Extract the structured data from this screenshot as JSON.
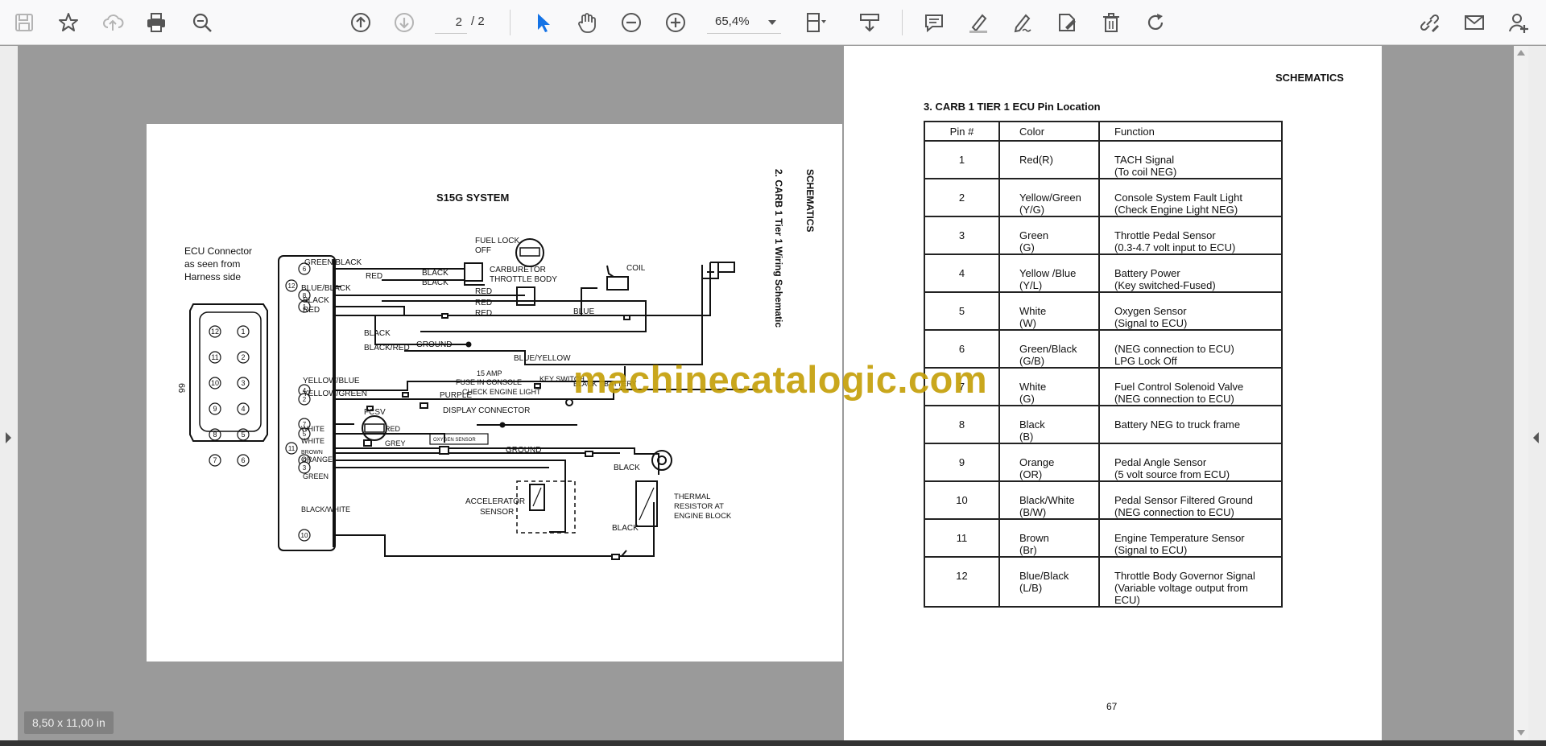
{
  "toolbar": {
    "icons": [
      "save-icon",
      "bookmark-star-icon",
      "cloud-upload-icon",
      "print-icon",
      "search-zoom-icon",
      "arrow-up-circle-icon",
      "arrow-down-circle-icon",
      "cursor-icon",
      "hand-icon",
      "zoom-out-icon",
      "zoom-in-icon",
      "fit-page-icon",
      "scroll-mode-icon",
      "comment-icon",
      "highlighter-icon",
      "sign-pen-icon",
      "stamp-icon",
      "delete-icon",
      "rotate-icon",
      "link-edit-icon",
      "mail-icon",
      "user-add-icon"
    ],
    "page_current": "2",
    "page_total": "/ 2",
    "zoom": "65,4%"
  },
  "status": {
    "page_size": "8,50 x 11,00 in"
  },
  "watermark": "machinecatalogic.com",
  "left_page": {
    "system_title": "S15G SYSTEM",
    "section_vertical": "SCHEMATICS",
    "diagram_vertical": "2. CARB 1 Tier 1 Wiring Schematic",
    "ecu_connector_label_1": "ECU Connector",
    "ecu_connector_label_2": "as seen from",
    "ecu_connector_label_3": "Harness side",
    "connector_code": "66",
    "connector_pins_left": [
      "12",
      "11",
      "10",
      "9",
      "8",
      "7"
    ],
    "connector_pins_right": [
      "1",
      "2",
      "3",
      "4",
      "5",
      "6"
    ],
    "labels": {
      "green_black": "GREEN/BLACK",
      "blue_black": "BLUE/BLACK",
      "black": "BLACK",
      "red": "RED",
      "red2": "RED",
      "red3": "RED",
      "red4": "RED",
      "black2": "BLACK",
      "black3": "BLACK",
      "black_red": "BLACK/RED",
      "ground1": "GROUND",
      "yellow_blue": "YELLOW/BLUE",
      "yellow_green": "YELLOW/GREEN",
      "purple": "PURPLE",
      "display_connector": "DISPLAY CONNECTOR",
      "fcsv": "FCSV",
      "white": "WHITE",
      "red5": "RED",
      "white2": "WHITE",
      "grey": "GREY",
      "oxygen_sensor": "OXYGEN SENSOR",
      "ground2": "GROUND",
      "brown": "BROWN",
      "orange": "ORANGE",
      "green": "GREEN",
      "black_white": "BLACK/WHITE",
      "fuel_lock": "FUEL LOCK",
      "off": "OFF",
      "carburetor": "CARBURETOR",
      "throttle_body": "THROTTLE BODY",
      "coil": "COIL",
      "blue": "BLUE",
      "blue_yellow": "BLUE/YELLOW",
      "fuse_1": "15 AMP",
      "fuse_2": "FUSE IN CONSOLE",
      "key_switch": "KEY SWITCH",
      "black_battery": "BLACK",
      "battery": "BATTERY",
      "check_engine": "CHECK ENGINE LIGHT",
      "accelerator_1": "ACCELERATOR",
      "accelerator_2": "SENSOR",
      "black4": "BLACK",
      "black5": "BLACK",
      "thermal_1": "THERMAL",
      "thermal_2": "RESISTOR AT",
      "thermal_3": "ENGINE BLOCK"
    },
    "pin_numbers": {
      "p6": "6",
      "p12": "12",
      "p8": "8",
      "p1": "1",
      "p4": "4",
      "p2": "2",
      "p7": "7",
      "p5": "5",
      "p11": "11",
      "p9": "9",
      "p3": "3",
      "p10": "10"
    }
  },
  "right_page": {
    "header": "SCHEMATICS",
    "title": "3. CARB 1 TIER 1 ECU Pin Location",
    "columns": [
      "Pin #",
      "Color",
      "Function"
    ],
    "rows": [
      {
        "pin": "1",
        "color": [
          "Red(R)"
        ],
        "function": [
          "TACH Signal",
          "(To coil NEG)"
        ]
      },
      {
        "pin": "2",
        "color": [
          "Yellow/Green",
          "(Y/G)"
        ],
        "function": [
          "Console System Fault Light",
          "(Check Engine Light NEG)"
        ]
      },
      {
        "pin": "3",
        "color": [
          "Green",
          "(G)"
        ],
        "function": [
          "Throttle Pedal Sensor",
          "(0.3-4.7 volt input to ECU)"
        ]
      },
      {
        "pin": "4",
        "color": [
          "Yellow /Blue",
          "(Y/L)"
        ],
        "function": [
          "Battery Power",
          "(Key switched-Fused)"
        ]
      },
      {
        "pin": "5",
        "color": [
          "White",
          "(W)"
        ],
        "function": [
          "Oxygen Sensor",
          "(Signal to ECU)"
        ]
      },
      {
        "pin": "6",
        "color": [
          "Green/Black",
          "(G/B)"
        ],
        "function": [
          "(NEG connection to ECU)",
          "LPG Lock Off"
        ]
      },
      {
        "pin": "7",
        "color": [
          "White",
          "(G)"
        ],
        "function": [
          "Fuel Control Solenoid Valve",
          "(NEG connection to ECU)"
        ]
      },
      {
        "pin": "8",
        "color": [
          "Black",
          "(B)"
        ],
        "function": [
          "Battery NEG to truck frame"
        ]
      },
      {
        "pin": "9",
        "color": [
          "Orange",
          "(OR)"
        ],
        "function": [
          "Pedal Angle Sensor",
          "(5 volt source from ECU)"
        ]
      },
      {
        "pin": "10",
        "color": [
          "Black/White",
          "(B/W)"
        ],
        "function": [
          "Pedal Sensor Filtered Ground",
          "(NEG connection to ECU)"
        ]
      },
      {
        "pin": "11",
        "color": [
          "Brown",
          "(Br)"
        ],
        "function": [
          "Engine Temperature Sensor",
          "(Signal to ECU)"
        ]
      },
      {
        "pin": "12",
        "color": [
          "Blue/Black",
          "(L/B)"
        ],
        "function": [
          "Throttle Body Governor Signal",
          "(Variable voltage output from ECU)"
        ]
      }
    ],
    "page_number": "67"
  }
}
